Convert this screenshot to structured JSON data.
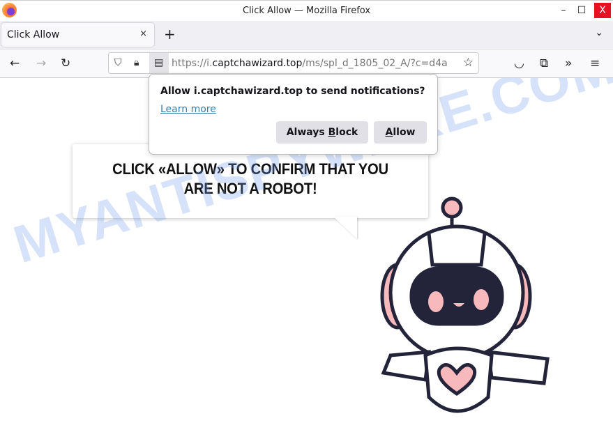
{
  "window": {
    "title": "Click Allow — Mozilla Firefox",
    "minimize": "–",
    "maximize": "☐",
    "close": "X"
  },
  "tab": {
    "label": "Click Allow",
    "close": "×",
    "new_tab": "+",
    "list": "⌄"
  },
  "nav": {
    "back": "←",
    "forward": "→",
    "reload": "↻",
    "url_prefix": "https://i.",
    "url_domain": "captchawizard.top",
    "url_rest": "/ms/spl_d_1805_02_A/?c=d4a",
    "star": "☆",
    "pocket": "◡",
    "extensions": "⧉",
    "overflow": "»",
    "menu": "≡"
  },
  "popup": {
    "question": "Allow i.captchawizard.top to send notifications?",
    "learn_more": "Learn more",
    "block_pre": "Always ",
    "block_u": "B",
    "block_post": "lock",
    "allow_u": "A",
    "allow_post": "llow"
  },
  "page": {
    "line1": "CLICK «ALLOW» TO CONFIRM THAT YOU",
    "line2": "ARE NOT A ROBOT!"
  },
  "watermark": "MYANTISPYWARE.COM"
}
